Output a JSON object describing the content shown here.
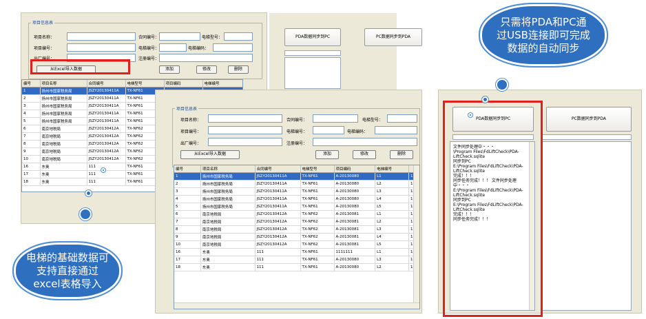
{
  "back_window": {
    "legend": "项目信息表",
    "labels": [
      "项目名称：",
      "合同编号：",
      "电梯型号：",
      "项目编号：",
      "电梯编号：",
      "电梯编码：",
      "出厂编号：",
      "注册编号："
    ],
    "buttons": {
      "import": "从Excel导入数据",
      "add": "添加",
      "edit": "修改",
      "delete": "删除"
    },
    "sync_to_pc": "PDA数据同步到PC",
    "sync_to_pda": "PC数据同步到PDA",
    "columns": [
      "编号",
      "项目名称",
      "合同编号",
      "电梯型号",
      "项目编码",
      "电梯编号"
    ],
    "rows": [
      [
        "1",
        "扬州市国家税务局",
        "JSZY20130411A",
        "TX-NF61"
      ],
      [
        "2",
        "扬州市国家税务局",
        "JSZY20130411A",
        "TX-NF61"
      ],
      [
        "3",
        "扬州市国家税务局",
        "JSZY20130411A",
        "TX-NF61"
      ],
      [
        "4",
        "扬州市国家税务局",
        "JSZY20130411A",
        "TX-NF61"
      ],
      [
        "5",
        "扬州市国家税务局",
        "JSZY20130411A",
        "TX-NF61"
      ],
      [
        "6",
        "南京地税局",
        "JSZY20130412A",
        "TX-NF62"
      ],
      [
        "7",
        "南京地税局",
        "JSZY20130412A",
        "TX-NF62"
      ],
      [
        "8",
        "南京地税局",
        "JSZY20130412A",
        "TX-NF62"
      ],
      [
        "9",
        "南京地税局",
        "JSZY20130412A",
        "TX-NF62"
      ],
      [
        "10",
        "南京地税局",
        "JSZY20130412A",
        "TX-NF62"
      ],
      [
        "16",
        "东奥",
        "111",
        "TX-NF61"
      ],
      [
        "17",
        "东奥",
        "111",
        "TX-NF61"
      ],
      [
        "18",
        "东奥",
        "111",
        "TX-NF61"
      ]
    ]
  },
  "front_window": {
    "legend": "项目信息表",
    "labels": [
      "项目名称：",
      "合同编号：",
      "电梯型号：",
      "项目编号：",
      "电梯编号：",
      "电梯编码：",
      "出厂编号：",
      "注册编号："
    ],
    "buttons": {
      "import": "从Excel导入数据",
      "add": "添加",
      "edit": "修改",
      "delete": "删除"
    },
    "columns": [
      "编号",
      "项目名称",
      "合同编号",
      "电梯型号",
      "项目编码",
      "电梯编号"
    ],
    "rows": [
      [
        "1",
        "扬州市国家税务局",
        "JSZY20130411A",
        "TX-NF61",
        "A-20130080",
        "L1"
      ],
      [
        "2",
        "扬州市国家税务局",
        "JSZY20130411A",
        "TX-NF61",
        "A-20130080",
        "L2"
      ],
      [
        "3",
        "扬州市国家税务局",
        "JSZY20130411A",
        "TX-NF61",
        "A-20130080",
        "L3"
      ],
      [
        "4",
        "扬州市国家税务局",
        "JSZY20130411A",
        "TX-NF61",
        "A-20130080",
        "L4"
      ],
      [
        "5",
        "扬州市国家税务局",
        "JSZY20130411A",
        "TX-NF61",
        "A-20130080",
        "L5"
      ],
      [
        "6",
        "南京地税局",
        "JSZY20130412A",
        "TX-NF62",
        "A-20130081",
        "L1"
      ],
      [
        "7",
        "南京地税局",
        "JSZY20130412A",
        "TX-NF62",
        "A-20130081",
        "L2"
      ],
      [
        "8",
        "南京地税局",
        "JSZY20130412A",
        "TX-NF62",
        "A-20130081",
        "L3"
      ],
      [
        "9",
        "南京地税局",
        "JSZY20130412A",
        "TX-NF62",
        "A-20130081",
        "L4"
      ],
      [
        "10",
        "南京地税局",
        "JSZY20130412A",
        "TX-NF62",
        "A-20130081",
        "L5"
      ],
      [
        "16",
        "东奥",
        "111",
        "TX-NF61",
        "1111111",
        "L1"
      ],
      [
        "17",
        "东奥",
        "111",
        "TX-NF61",
        "A-20130080",
        "L3"
      ],
      [
        "18",
        "东奥",
        "111",
        "TX-NF61",
        "A-20130080",
        "L2"
      ]
    ],
    "extra_col": "1"
  },
  "sync_window": {
    "sync_to_pc": "PDA数据同步到PC",
    "sync_to_pda": "PC数据同步到PDA",
    "log": "文件同步处理中・・・\n\\Program Files\\FdLiftCheck\\PDA-LiftCheck.sqlite\n同步到PC\nE:\\Program Files\\FdLiftCheck\\PDA-LiftCheck.sqlite\n完成！！！\n同步任务完成！！！ 文件同步处理中・・・\nE:\\Program Files\\FdLiftCheck\\PDA-LiftCheck.sqlite\n同步到PC\nE:\\Program Files\\FdLiftCheck\\PDA-LiftCheck.sqlite\n完成！！！\n同步任务完成！！！"
  },
  "callouts": {
    "top_right": "只需将PDA和PC通过USB连接即可完成数据的自动同步",
    "bottom_left": "电梯的基础数据可支持直接通过excel表格导入"
  },
  "colors": {
    "accent_red": "#e0201c",
    "bubble_blue": "#2e6fbf",
    "selection": "#316ac5"
  }
}
